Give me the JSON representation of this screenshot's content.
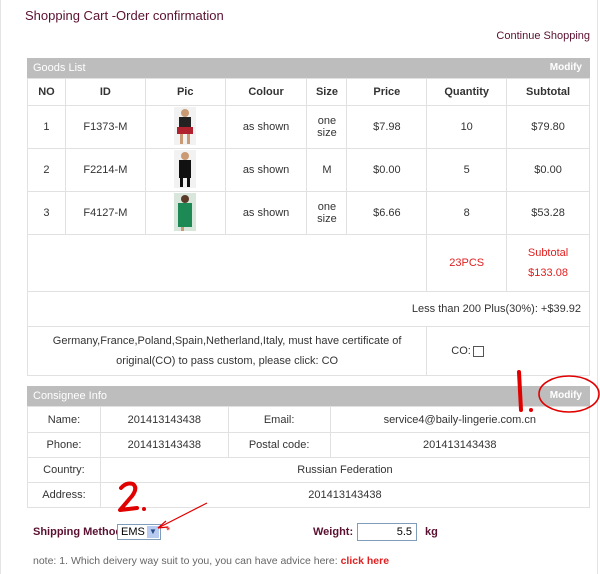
{
  "page": {
    "title": "Shopping Cart -Order confirmation",
    "continue_shopping": "Continue Shopping"
  },
  "goods": {
    "bar_title": "Goods List",
    "modify_label": "Modify",
    "headers": [
      "NO",
      "ID",
      "Pic",
      "Colour",
      "Size",
      "Price",
      "Quantity",
      "Subtotal"
    ],
    "rows": [
      {
        "no": "1",
        "id": "F1373-M",
        "colour": "as shown",
        "size": "one size",
        "price": "$7.98",
        "quantity": "10",
        "subtotal": "$79.80"
      },
      {
        "no": "2",
        "id": "F2214-M",
        "colour": "as shown",
        "size": "M",
        "price": "$0.00",
        "quantity": "5",
        "subtotal": "$0.00"
      },
      {
        "no": "3",
        "id": "F4127-M",
        "colour": "as shown",
        "size": "one size",
        "price": "$6.66",
        "quantity": "8",
        "subtotal": "$53.28"
      }
    ],
    "total_pcs": "23PCS",
    "subtotal_label": "Subtotal",
    "subtotal_value": "$133.08",
    "plus_note": "Less than 200 Plus(30%): +$39.92",
    "co_note": "Germany,France,Poland,Spain,Netherland,Italy, must have certificate of original(CO) to pass custom, please click: CO",
    "co_label": "CO:"
  },
  "consignee": {
    "bar_title": "Consignee Info",
    "modify_label": "Modify",
    "name_label": "Name:",
    "name_value": "201413143438",
    "email_label": "Email:",
    "email_value": "service4@baily-lingerie.com.cn",
    "phone_label": "Phone:",
    "phone_value": "201413143438",
    "postal_label": "Postal code:",
    "postal_value": "201413143438",
    "country_label": "Country:",
    "country_value": "Russian Federation",
    "address_label": "Address:",
    "address_value": "201413143438"
  },
  "shipping": {
    "label": "Shipping Method",
    "selected": "EMS",
    "required_mark": "*",
    "weight_label": "Weight:",
    "weight_value": "5.5",
    "weight_unit": "kg",
    "note_prefix": "note: 1. Which deivery way suit to you, you can have advice here:",
    "note_link": "click here"
  },
  "annotations": {
    "mark_1": "1.",
    "mark_2": "2."
  },
  "colors": {
    "bar": "#bdbdbd",
    "accent_text": "#5a1030",
    "red": "#e02020",
    "annotation": "#e00000"
  },
  "icons": [
    "chevron-down-icon",
    "checkbox-icon"
  ]
}
